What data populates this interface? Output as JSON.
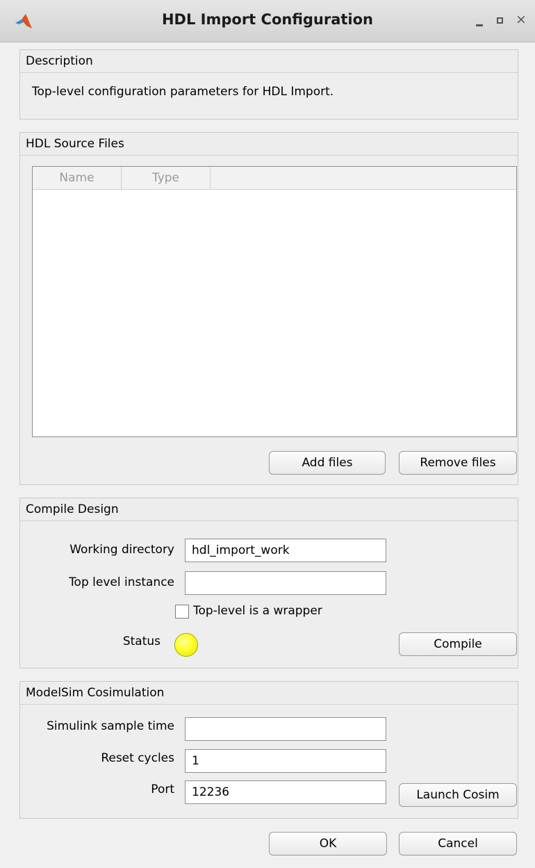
{
  "window": {
    "title": "HDL Import Configuration"
  },
  "description": {
    "header": "Description",
    "text": "Top-level configuration parameters for HDL Import."
  },
  "sources": {
    "header": "HDL Source Files",
    "columns": [
      "Name",
      "Type"
    ],
    "rows": [],
    "add_label": "Add files",
    "remove_label": "Remove files"
  },
  "compile": {
    "header": "Compile Design",
    "workdir_label": "Working directory",
    "workdir_value": "hdl_import_work",
    "toplevel_label": "Top level instance",
    "toplevel_value": "",
    "wrapper_label": "Top-level is a wrapper",
    "wrapper_checked": false,
    "status_label": "Status",
    "status_color": "#ffff2a",
    "compile_label": "Compile"
  },
  "cosim": {
    "header": "ModelSim Cosimulation",
    "sample_time_label": "Simulink sample time",
    "sample_time_value": "",
    "reset_label": "Reset cycles",
    "reset_value": "1",
    "port_label": "Port",
    "port_value": "12236",
    "launch_label": "Launch Cosim"
  },
  "footer": {
    "ok_label": "OK",
    "cancel_label": "Cancel"
  }
}
